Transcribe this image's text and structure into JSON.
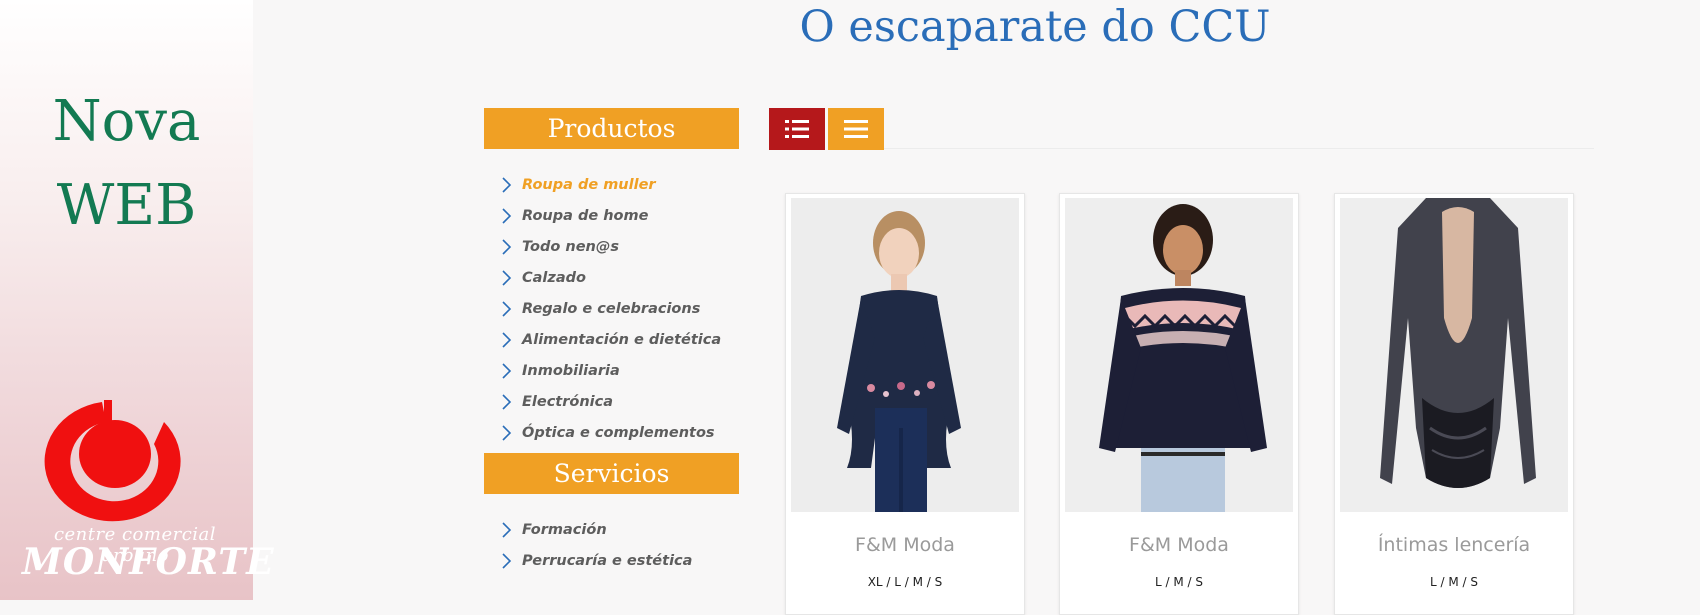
{
  "promo": {
    "line1": "Nova",
    "line2": "WEB"
  },
  "logo": {
    "line1": "centre comercial urbano",
    "line2": "MONFORTE"
  },
  "page_title": "O escaparate do CCU",
  "sidebar": {
    "products_header": "Productos",
    "products": [
      {
        "label": "Roupa de muller",
        "active": true
      },
      {
        "label": "Roupa de home",
        "active": false
      },
      {
        "label": "Todo nen@s",
        "active": false
      },
      {
        "label": "Calzado",
        "active": false
      },
      {
        "label": "Regalo e celebracions",
        "active": false
      },
      {
        "label": "Alimentación e dietética",
        "active": false
      },
      {
        "label": "Inmobiliaria",
        "active": false
      },
      {
        "label": "Electrónica",
        "active": false
      },
      {
        "label": "Óptica e complementos",
        "active": false
      }
    ],
    "services_header": "Servicios",
    "services": [
      {
        "label": "Formación"
      },
      {
        "label": "Perrucaría e estética"
      }
    ]
  },
  "toolbar": {
    "views": [
      {
        "icon": "list-detailed-icon",
        "active": true
      },
      {
        "icon": "list-simple-icon",
        "active": false
      }
    ]
  },
  "products": [
    {
      "name": "F&M Moda",
      "sizes": "XL / L / M / S",
      "image": "woman-embroidered-sweater"
    },
    {
      "name": "F&M Moda",
      "sizes": "L / M / S",
      "image": "woman-fairisle-sweater"
    },
    {
      "name": "Íntimas lencería",
      "sizes": "L / M / S",
      "image": "black-lace-bodysuit"
    }
  ],
  "colors": {
    "accent": "#f0a024",
    "active_view": "#b5181b",
    "title_blue": "#2a6db8",
    "promo_green": "#137a52",
    "logo_red": "#f01010"
  }
}
